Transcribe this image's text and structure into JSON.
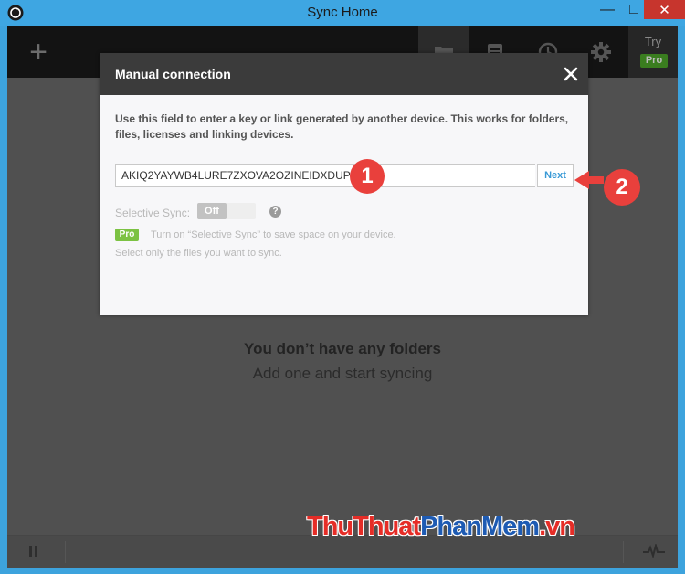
{
  "window": {
    "title": "Sync Home",
    "minimize_glyph": "—",
    "maximize_glyph": "□",
    "close_glyph": "✕"
  },
  "toolbar": {
    "add_glyph": "+",
    "tools": [
      "folder-icon",
      "list-icon",
      "clock-icon",
      "gear-icon"
    ],
    "try_label": "Try",
    "pro_label": "Pro"
  },
  "empty_state": {
    "title": "You don’t have any folders",
    "subtitle": "Add one and start syncing"
  },
  "modal": {
    "title": "Manual connection",
    "description": "Use this field to enter a key or link generated by another device. This works for folders, files, licenses and linking devices.",
    "key_value": "AKIQ2YAYWB4LURE7ZXOVA2OZINEIDXDUP",
    "next_label": "Next",
    "selective_sync_label": "Selective Sync:",
    "toggle_label": "Off",
    "help_glyph": "?",
    "pro_badge": "Pro",
    "promo_line1": "Turn on “Selective Sync” to save space on your device.",
    "promo_line2": "Select only the files you want to sync."
  },
  "annotations": {
    "step1": "1",
    "step2": "2",
    "color": "#e9403c"
  },
  "watermark": {
    "part1": "ThuThuat",
    "part2": "PhanMem",
    "part3": ".vn"
  },
  "colors": {
    "titlebar": "#3ea6e2",
    "close_button": "#c7352d",
    "accent_link": "#3a9ad6",
    "pro_green": "#7cc243"
  }
}
